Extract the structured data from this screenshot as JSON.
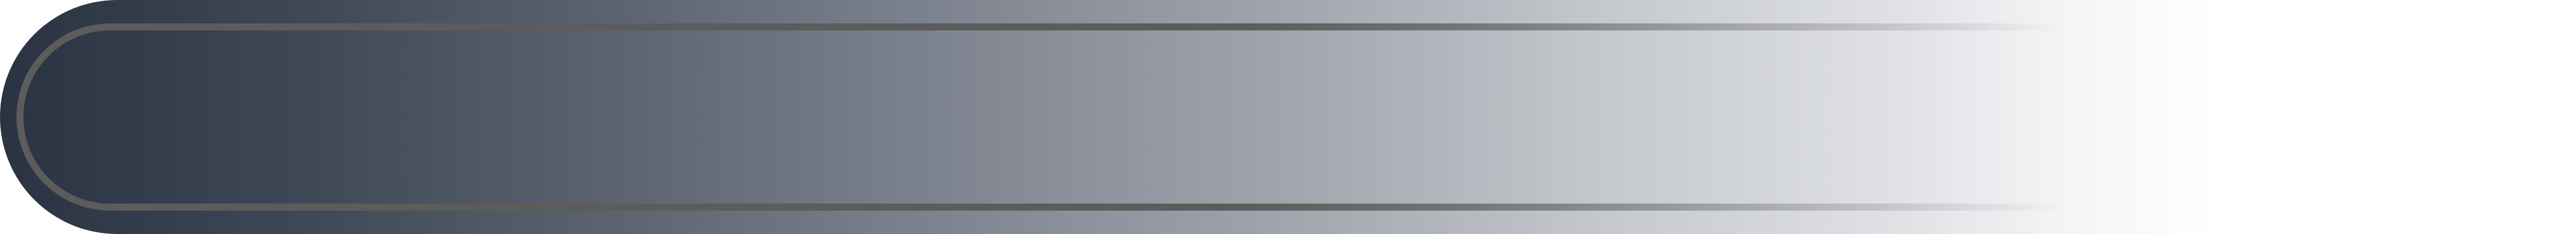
{
  "banner": {
    "colors": {
      "start": "#2a3342",
      "end": "#ffffff",
      "outline": "#5c5c5c"
    }
  }
}
